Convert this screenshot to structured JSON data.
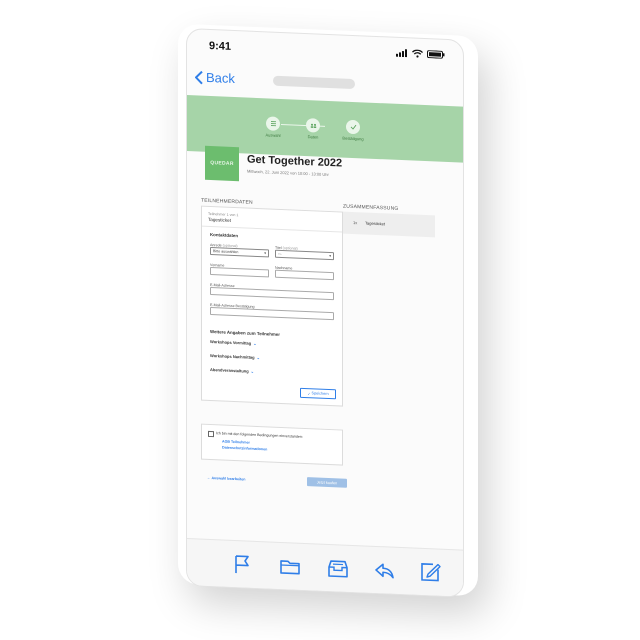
{
  "status_bar": {
    "time": "9:41"
  },
  "nav": {
    "back_label": "Back"
  },
  "steps": [
    {
      "label": "Auswahl"
    },
    {
      "label": "Daten"
    },
    {
      "label": "Bestätigung"
    }
  ],
  "event": {
    "logo_text": "QUEDAR",
    "title": "Get Together 2022",
    "date": "Mittwoch, 22. Juni 2022 von 10:00 - 13:00 Uhr"
  },
  "sections": {
    "participants": "TEILNEHMERDATEN",
    "summary": "ZUSAMMENFASSUNG"
  },
  "participant_card": {
    "counter": "Teilnehmer 1 von 1",
    "ticket": "Tagesticket",
    "contact_heading": "Kontaktdaten",
    "anrede_label": "Anrede",
    "anrede_optional": "(optional)",
    "anrede_value": "Bitte auswählen",
    "titel_label": "Titel",
    "titel_optional": "(optional)",
    "titel_value": "---",
    "vorname_label": "Vorname",
    "nachname_label": "Nachname",
    "email_label": "E-Mail-Adresse",
    "email_confirm_label": "E-Mail-Adresse Bestätigung",
    "more_heading": "Weitere Angaben zum Teilnehmer",
    "workshops_am": "Workshops Vormittag",
    "workshops_pm": "Workshops Nachmittag",
    "evening": "Abendveranstaltung",
    "save_label": "Speichern"
  },
  "terms": {
    "text": "Ich bin mit den folgenden Bedingungen einverstanden:",
    "link_agb": "AGB Teilnehmer",
    "link_privacy": "Datenschutzinformationen"
  },
  "footer_actions": {
    "edit_selection": "Auswahl bearbeiten",
    "buy_now": "Jetzt kaufen"
  },
  "summary": {
    "qty": "1x",
    "item": "Tagesticket"
  },
  "colors": {
    "accent": "#2f7ee8",
    "band": "#a6d4a8",
    "logo": "#6cbd6e"
  },
  "toolbar_icons": [
    "flag-icon",
    "folder-icon",
    "archive-icon",
    "reply-icon",
    "compose-icon"
  ]
}
